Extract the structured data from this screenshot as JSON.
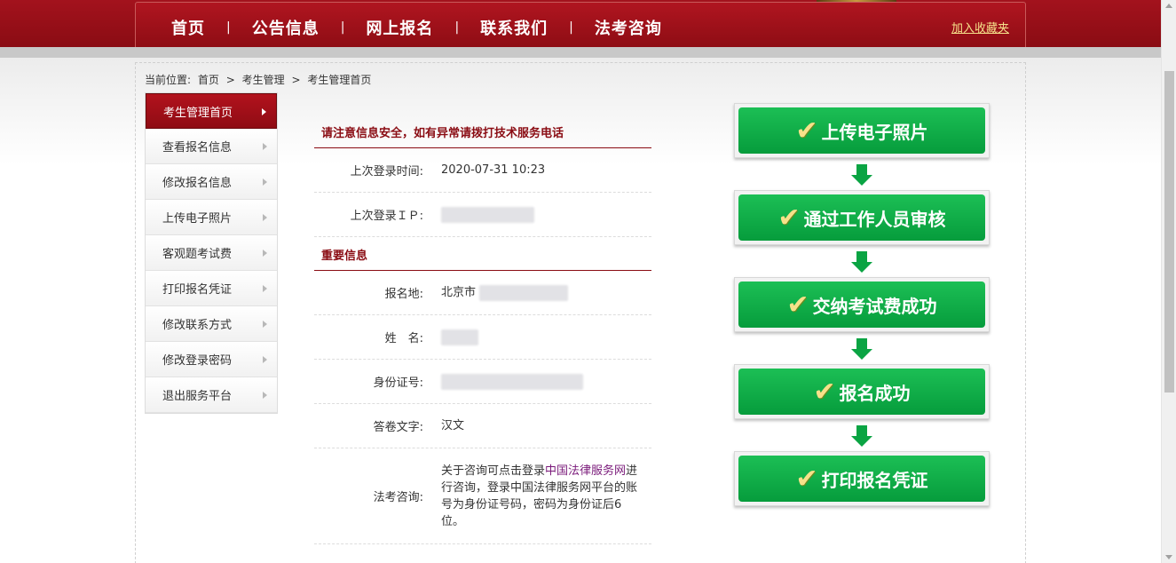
{
  "nav": {
    "items": [
      "首页",
      "公告信息",
      "网上报名",
      "联系我们",
      "法考咨询"
    ],
    "separator": "|",
    "favorite": "加入收藏夹"
  },
  "breadcrumb": {
    "prefix": "当前位置:",
    "items": [
      "首页",
      "考生管理",
      "考生管理首页"
    ],
    "sep": ">"
  },
  "sidebar": {
    "items": [
      {
        "label": "考生管理首页",
        "active": true
      },
      {
        "label": "查看报名信息"
      },
      {
        "label": "修改报名信息"
      },
      {
        "label": "上传电子照片"
      },
      {
        "label": "客观题考试费"
      },
      {
        "label": "打印报名凭证"
      },
      {
        "label": "修改联系方式"
      },
      {
        "label": "修改登录密码"
      },
      {
        "label": "退出服务平台"
      }
    ]
  },
  "notice": "请注意信息安全，如有异常请拨打技术服务电话",
  "login": {
    "last_time_label": "上次登录时间:",
    "last_time_value": "2020-07-31 10:23",
    "last_ip_label": "上次登录ＩＰ:"
  },
  "important": {
    "title": "重要信息",
    "place_label": "报名地:",
    "place_value": "北京市",
    "name_label": "姓　名:",
    "id_label": "身份证号:",
    "lang_label": "答卷文字:",
    "lang_value": "汉文",
    "consult_label": "法考咨询:",
    "consult_text_1": "关于咨询可点击登录",
    "consult_link": "中国法律服务网",
    "consult_text_2": "进行咨询，登录中国法律服务网平台的账号为身份证号码，密码为身份证后6位。"
  },
  "steps": [
    "上传电子照片",
    "通过工作人员审核",
    "交纳考试费成功",
    "报名成功",
    "打印报名凭证"
  ],
  "colors": {
    "brand_red": "#8a0c13",
    "step_green": "#069c3c"
  }
}
